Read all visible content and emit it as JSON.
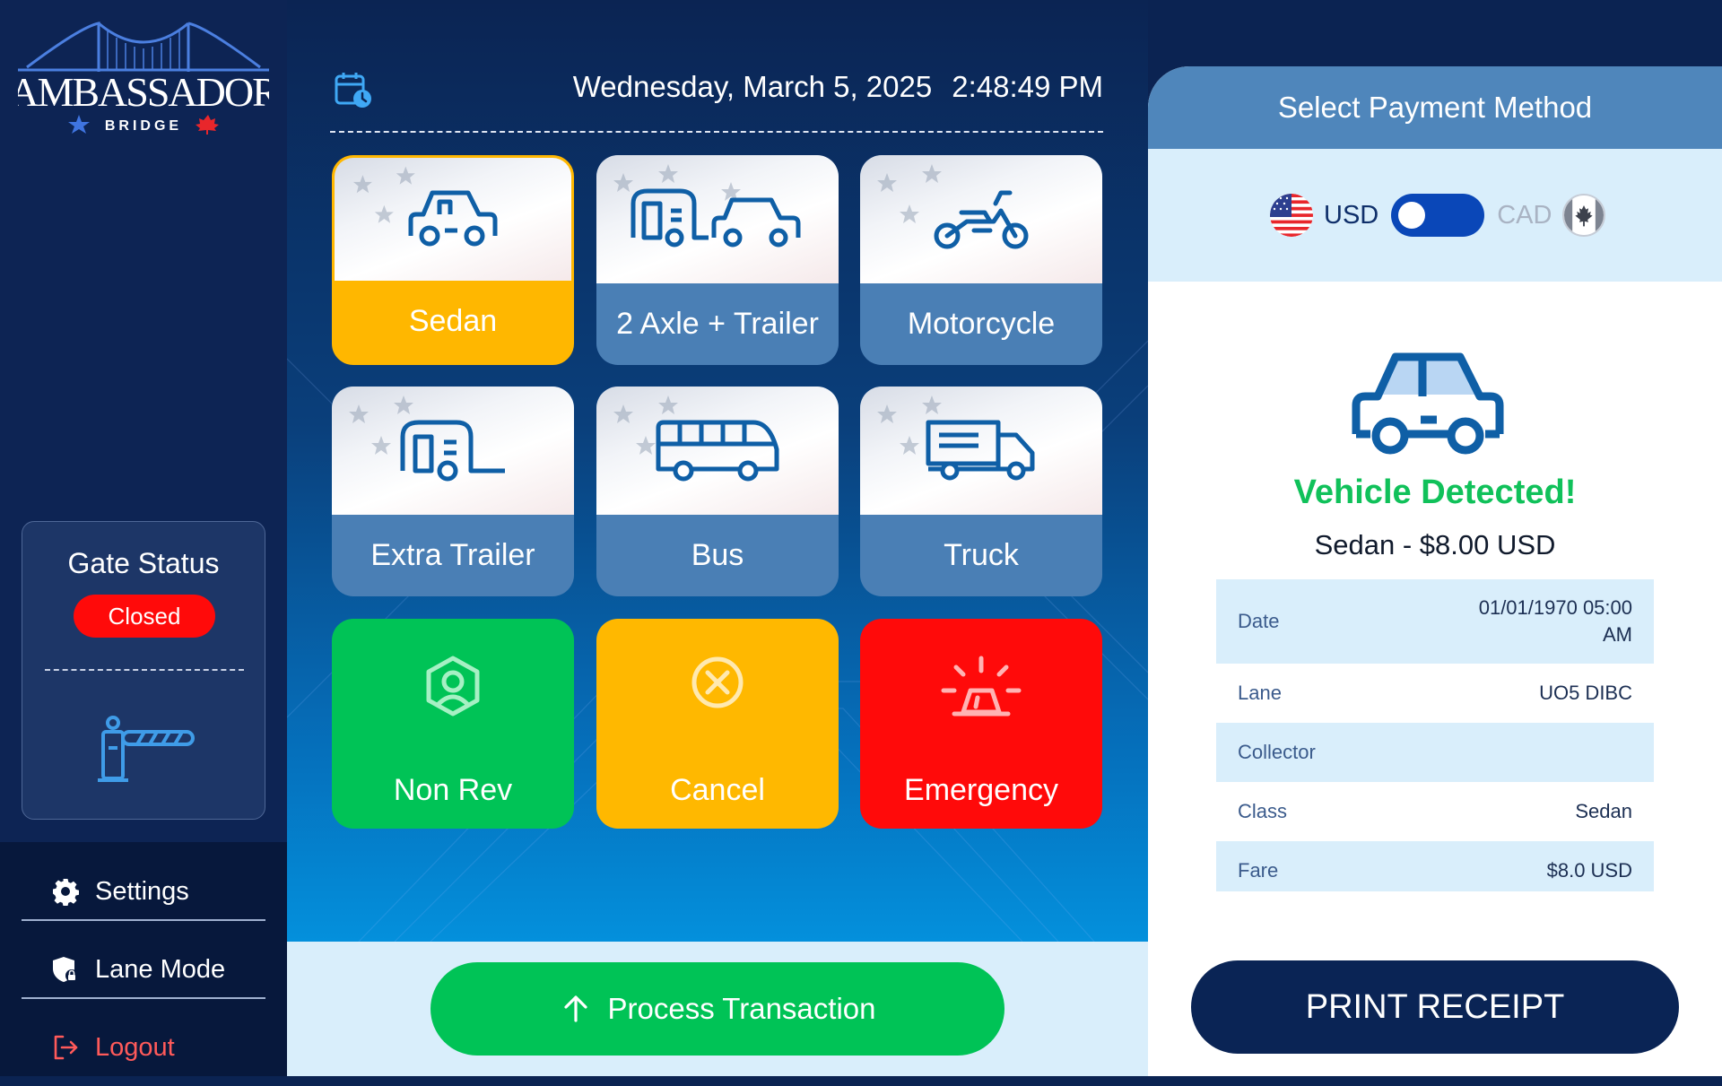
{
  "brand": {
    "name": "AMBASSADOR",
    "tagline": "BRIDGE"
  },
  "gate": {
    "title": "Gate Status",
    "status": "Closed"
  },
  "nav": {
    "settings": "Settings",
    "lane_mode": "Lane Mode",
    "logout": "Logout"
  },
  "header": {
    "date": "Wednesday, March 5, 2025",
    "time": "2:48:49 PM"
  },
  "vehicles": {
    "sedan": "Sedan",
    "axle_trailer": "2 Axle + Trailer",
    "motorcycle": "Motorcycle",
    "extra_trailer": "Extra Trailer",
    "bus": "Bus",
    "truck": "Truck"
  },
  "actions": {
    "non_rev": "Non Rev",
    "cancel": "Cancel",
    "emergency": "Emergency"
  },
  "process": {
    "label": "Process Transaction"
  },
  "payment": {
    "title": "Select Payment Method",
    "usd": "USD",
    "cad": "CAD",
    "selected_currency": "USD"
  },
  "detection": {
    "title": "Vehicle Detected!",
    "summary": "Sedan - $8.00 USD"
  },
  "receipt_info": {
    "date_label": "Date",
    "date_value": "01/01/1970 05:00 AM",
    "lane_label": "Lane",
    "lane_value": "UO5 DIBC",
    "collector_label": "Collector",
    "collector_value": "",
    "class_label": "Class",
    "class_value": "Sedan",
    "fare_label": "Fare",
    "fare_value": "$8.0 USD"
  },
  "print": {
    "label": "PRINT RECEIPT"
  },
  "colors": {
    "selected": "#ffb700",
    "tile_blue": "#4a7fb5",
    "green": "#00c356",
    "amber": "#ffb800",
    "red": "#ff0a0a",
    "navy": "#0a2455",
    "status_red": "#ff0a0a",
    "detected_green": "#10c15a"
  },
  "icons": {
    "calendar": "calendar-clock-icon",
    "settings": "gear-icon",
    "lane_mode": "shield-lock-icon",
    "logout": "logout-icon",
    "gate": "barrier-gate-icon",
    "process": "arrow-up-icon"
  }
}
